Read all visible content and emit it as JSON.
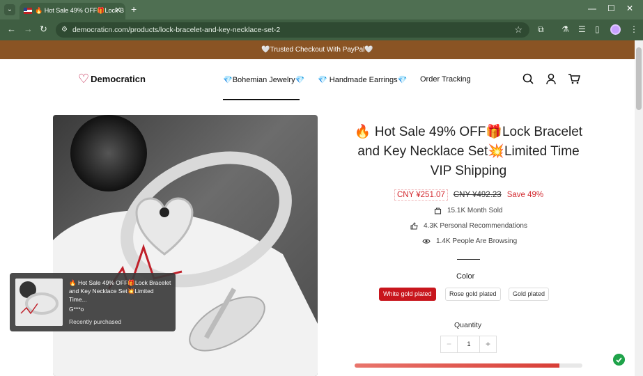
{
  "browser": {
    "tab_title": "🔥 Hot Sale 49% OFF🎁Lock B",
    "url": "democraticn.com/products/lock-bracelet-and-key-necklace-set-2"
  },
  "page": {
    "promo_text": "🤍Trusted Checkout With PayPal🤍",
    "logo_text": "Democraticn",
    "nav": {
      "bohemian": "💎Bohemian Jewelry💎",
      "earrings": "💎 Handmade Earrings💎",
      "tracking": "Order Tracking"
    }
  },
  "product": {
    "title": "🔥 Hot Sale 49% OFF🎁Lock Bracelet and Key Necklace Set💥Limited Time VIP Shipping",
    "price_now": "CNY ¥251.07",
    "price_old": "CNY ¥492.23",
    "save": "Save 49%",
    "stats": {
      "sold": "15.1K Month Sold",
      "recommend": "4.3K Personal Recommendations",
      "browsing": "1.4K People Are Browsing"
    },
    "color_label": "Color",
    "color_options": [
      "White gold plated",
      "Rose gold plated",
      "Gold plated"
    ],
    "selected_color": "White gold plated",
    "quantity_label": "Quantity",
    "quantity_value": "1",
    "stock_fraction": 0.9
  },
  "toast": {
    "title": "🔥 Hot Sale 49% OFF🎁Lock Bracelet and Key Necklace Set💥Limited Time...",
    "buyer": "G***o",
    "status": "Recently purchased"
  },
  "colors": {
    "chrome": "#3f5e42",
    "promo": "#8a5424",
    "accent_red": "#c8161d"
  }
}
